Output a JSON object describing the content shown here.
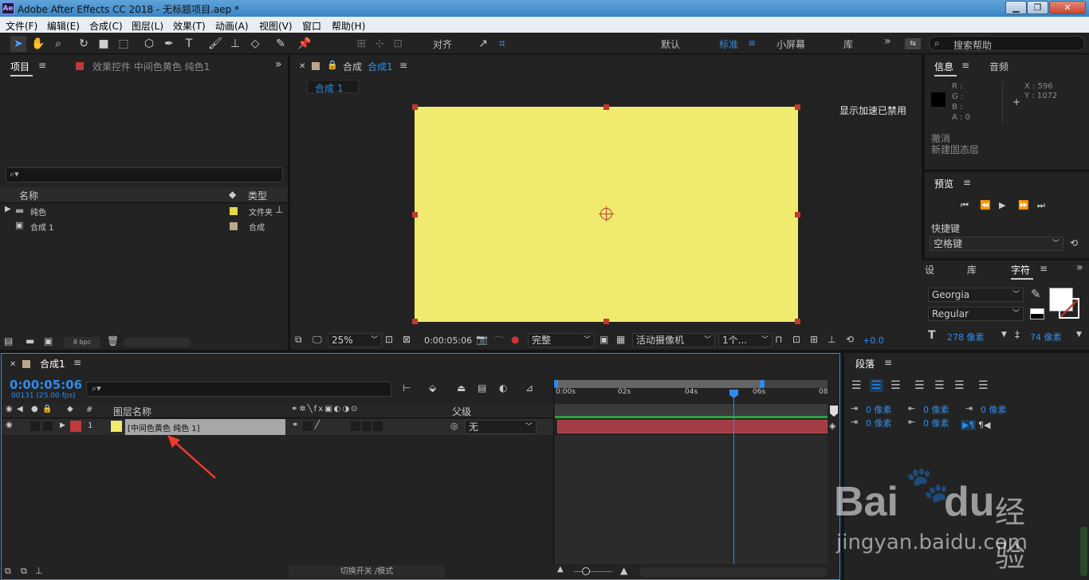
{
  "window": {
    "title": "Adobe After Effects CC 2018 - 无标题项目.aep *",
    "app_icon": "Ae",
    "btn_min": "▁",
    "btn_max": "❐",
    "btn_close": "✕"
  },
  "menu": [
    "文件(F)",
    "编辑(E)",
    "合成(C)",
    "图层(L)",
    "效果(T)",
    "动画(A)",
    "视图(V)",
    "窗口",
    "帮助(H)"
  ],
  "toolbar": {
    "align_label": "对齐",
    "workspaces": [
      "默认",
      "标准",
      "小屏幕",
      "库"
    ],
    "active_workspace": "标准",
    "search_placeholder": "搜索帮助",
    "more": "»"
  },
  "project": {
    "tab_label": "项目",
    "effects_tab": "效果控件 中间色黄色 纯色1",
    "search_placeholder": "",
    "col_name": "名称",
    "col_type": "类型",
    "items": [
      {
        "name": "纯色",
        "type": "文件夹",
        "color": "#e6d64a"
      },
      {
        "name": "合成 1",
        "type": "合成",
        "color": "#bba78a"
      }
    ],
    "bpc": "8 bpc"
  },
  "composition": {
    "tab_prefix": "合成",
    "tab_name": "合成1",
    "breadcrumb": "合成 1",
    "accel_notice": "显示加速已禁用",
    "solid_color": "#f0ea6e",
    "zoom": "25%",
    "timecode": "0:00:05:06",
    "resolution": "完整",
    "camera": "活动摄像机",
    "views": "1个...",
    "exposure": "+0.0"
  },
  "info": {
    "tab_info": "信息",
    "tab_audio": "音频",
    "r": "R :",
    "g": "G :",
    "b": "B :",
    "a": "A :  0",
    "x": "X : 596",
    "y": "Y : 1072",
    "undo": "撤消",
    "last_action": "新建固态层"
  },
  "preview": {
    "title": "预览",
    "shortcut_label": "快捷键",
    "shortcut_value": "空格键"
  },
  "character": {
    "tab_a": "设",
    "tab_b": "库",
    "tab_c": "字符",
    "font": "Georgia",
    "style": "Regular",
    "size": "278 像素",
    "leading": "74 像素"
  },
  "paragraph": {
    "title": "段落",
    "v0": "0 像素",
    "v1": "0 像素",
    "v2": "0 像素",
    "v3": "0 像素",
    "v4": "0 像素"
  },
  "timeline": {
    "tab_name": "合成1",
    "timecode": "0:00:05:06",
    "frames": "00131 (25.00 fps)",
    "search_placeholder": "",
    "col_layer_name": "图层名称",
    "col_num": "#",
    "col_parent": "父级",
    "ticks": [
      "0:00s",
      "02s",
      "04s",
      "06s",
      "08"
    ],
    "layer": {
      "index": "1",
      "name": "[中间色黄色 纯色 1]",
      "parent": "无"
    },
    "footer": "切换开关 /模式"
  },
  "watermark": {
    "brand": "Bai",
    "brand2": "du",
    "suffix": "经验",
    "url": "jingyan.baidu.com"
  }
}
